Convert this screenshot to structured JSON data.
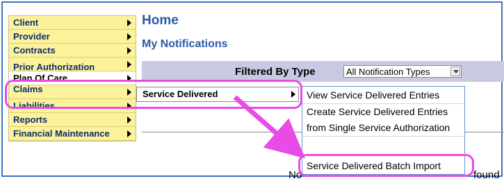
{
  "left_menu": {
    "items": [
      {
        "label": "Client"
      },
      {
        "label": "Provider"
      },
      {
        "label": "Contracts"
      },
      {
        "label": "Prior Authorization"
      },
      {
        "label": "Plan Of Care"
      },
      {
        "label": "Claims"
      },
      {
        "label": "Liabilities"
      },
      {
        "label": "Reports"
      },
      {
        "label": "Financial Maintenance"
      }
    ]
  },
  "main": {
    "page_title": "Home",
    "section_title": "My Notifications",
    "filter_label": "Filtered By Type",
    "filter_value": "All Notification Types",
    "empty_left": "No",
    "empty_right": "found"
  },
  "submenu_level1": {
    "label": "Service Delivered"
  },
  "submenu_level2": {
    "items": [
      {
        "label": "View Service Delivered Entries"
      },
      {
        "label": "Create Service Delivered Entries"
      },
      {
        "label": "from Single Service Authorization"
      },
      {
        "label": "Service Delivered Batch Import"
      }
    ]
  },
  "colors": {
    "menu_bg": "#fbf29b",
    "menu_text": "#0b2b6b",
    "title_blue": "#2c5aa7",
    "filter_band": "#c9c9e4",
    "highlight": "#e84be6"
  }
}
